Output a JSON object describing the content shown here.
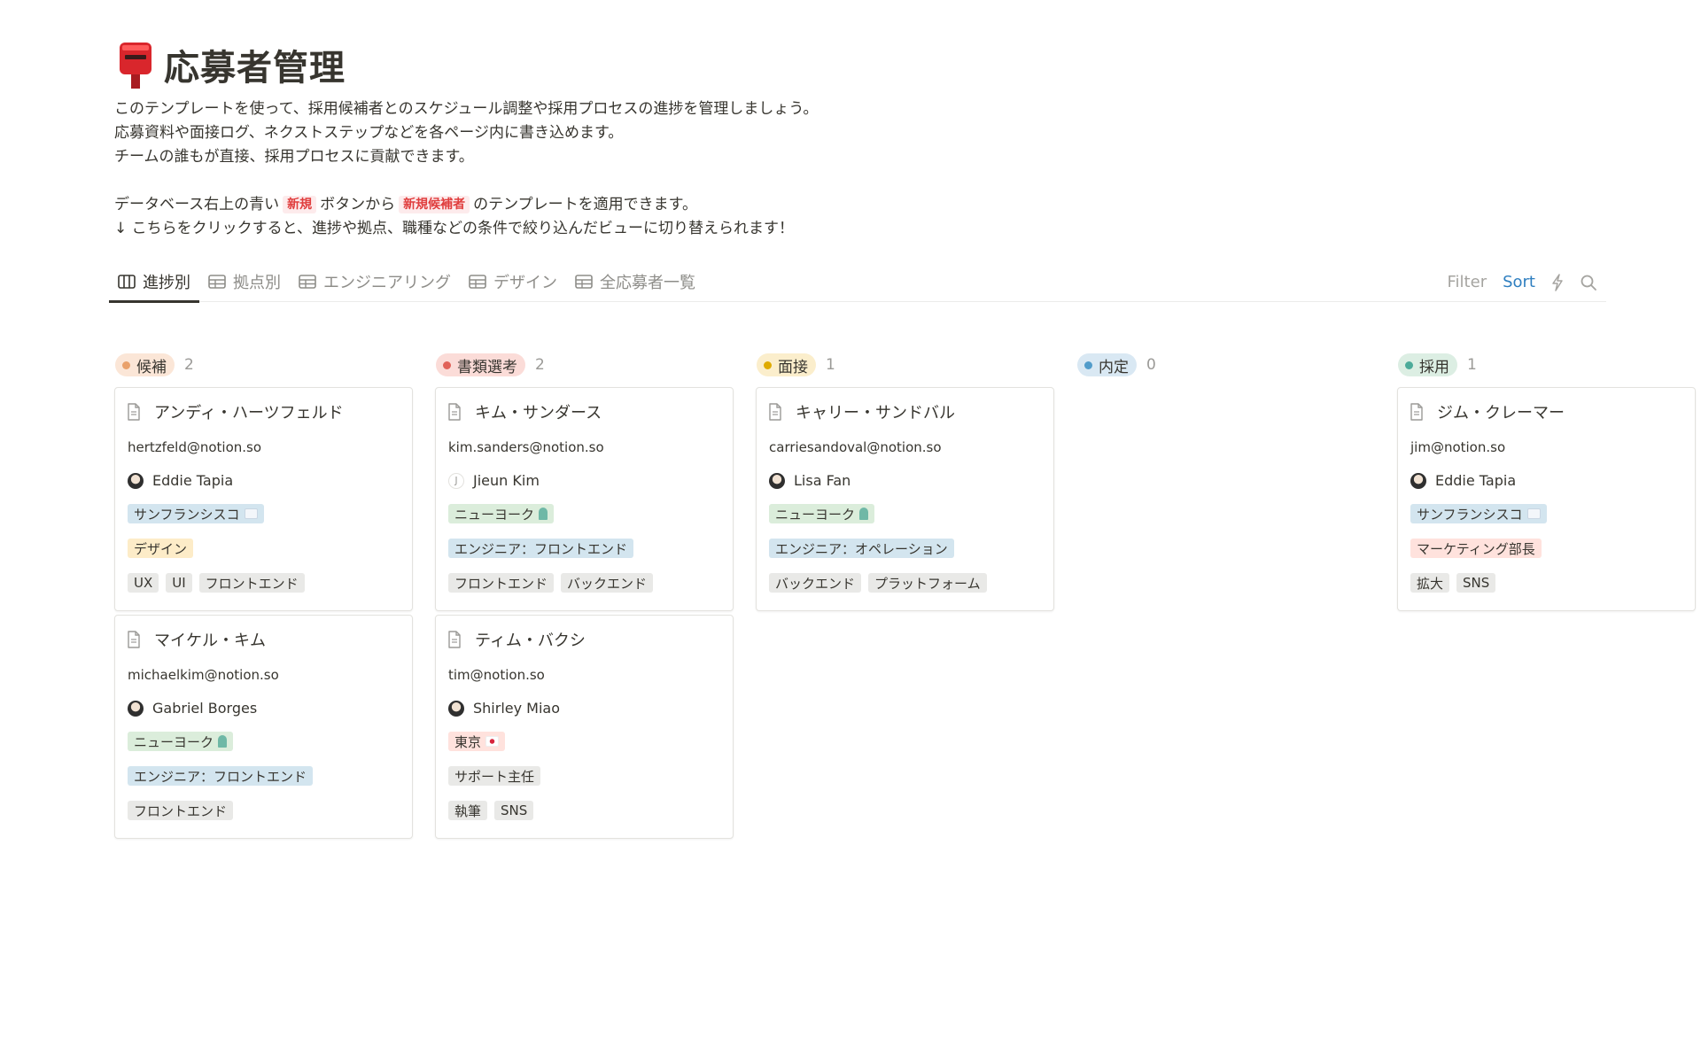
{
  "page": {
    "title": "応募者管理",
    "title_icon": "postbox-icon",
    "description": {
      "line1": "このテンプレートを使って、採用候補者とのスケジュール調整や採用プロセスの進捗を管理しましょう。",
      "line2": "応募資料や面接ログ、ネクストステップなどを各ページ内に書き込めます。",
      "line3": "チームの誰もが直接、採用プロセスに貢献できます。",
      "line4_pre": "データベース右上の青い",
      "line4_tag1": "新規",
      "line4_mid": "ボタンから",
      "line4_tag2": "新規候補者",
      "line4_post": "のテンプレートを適用できます。",
      "line5": "↓ こちらをクリックすると、進捗や拠点、職種などの条件で絞り込んだビューに切り替えられます！"
    }
  },
  "tabs": [
    {
      "label": "進捗別",
      "icon": "board-icon",
      "active": true
    },
    {
      "label": "拠点別",
      "icon": "table-icon"
    },
    {
      "label": "エンジニアリング",
      "icon": "table-icon"
    },
    {
      "label": "デザイン",
      "icon": "table-icon"
    },
    {
      "label": "全応募者一覧",
      "icon": "table-icon"
    }
  ],
  "toolbar": {
    "filter": "Filter",
    "sort": "Sort",
    "automation_icon": "lightning-icon",
    "search_icon": "search-icon"
  },
  "columns": [
    {
      "status": "候補",
      "count": "2",
      "color": "#e9a16b",
      "bg": "#fbe6d7",
      "cards": [
        {
          "name": "アンディ・ハーツフェルド",
          "email": "hertzfeld@notion.so",
          "person": "Eddie Tapia",
          "location": "サンフランシスコ",
          "role": "デザイン",
          "skills": [
            "UX",
            "UI",
            "フロントエンド"
          ]
        },
        {
          "name": "マイケル・キム",
          "email": "michaelkim@notion.so",
          "person": "Gabriel Borges",
          "location": "ニューヨーク",
          "role": "エンジニア：フロントエンド",
          "skills": [
            "フロントエンド"
          ]
        }
      ]
    },
    {
      "status": "書類選考",
      "count": "2",
      "color": "#e16259",
      "bg": "#fbdcd8",
      "cards": [
        {
          "name": "キム・サンダース",
          "email": "kim.sanders@notion.so",
          "person": "Jieun Kim",
          "person_initial": "J",
          "location": "ニューヨーク",
          "role": "エンジニア：フロントエンド",
          "skills": [
            "フロントエンド",
            "バックエンド"
          ]
        },
        {
          "name": "ティム・バクシ",
          "email": "tim@notion.so",
          "person": "Shirley Miao",
          "location": "東京",
          "role": "サポート主任",
          "skills": [
            "執筆",
            "SNS"
          ]
        }
      ]
    },
    {
      "status": "面接",
      "count": "1",
      "color": "#dfab01",
      "bg": "#fbeecc",
      "cards": [
        {
          "name": "キャリー・サンドバル",
          "email": "carriesandoval@notion.so",
          "person": "Lisa Fan",
          "location": "ニューヨーク",
          "role": "エンジニア：オペレーション",
          "skills": [
            "バックエンド",
            "プラットフォーム"
          ]
        }
      ]
    },
    {
      "status": "内定",
      "count": "0",
      "color": "#529cca",
      "bg": "#d9e8f3",
      "cards": []
    },
    {
      "status": "採用",
      "count": "1",
      "color": "#4dab9a",
      "bg": "#dceee3",
      "cards": [
        {
          "name": "ジム・クレーマー",
          "email": "jim@notion.so",
          "person": "Eddie Tapia",
          "location": "サンフランシスコ",
          "role": "マーケティング部長",
          "skills": [
            "拡大",
            "SNS"
          ]
        }
      ]
    }
  ]
}
